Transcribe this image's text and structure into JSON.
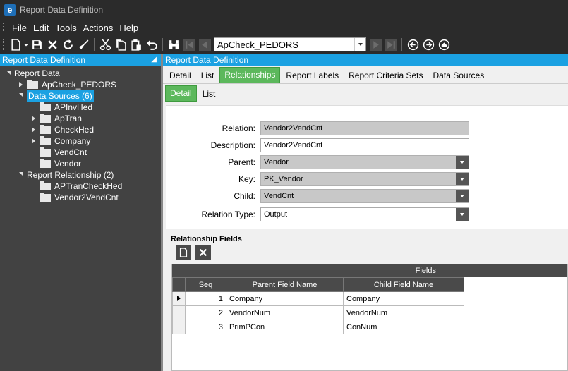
{
  "window": {
    "title": "Report Data Definition",
    "logo_letter": "e"
  },
  "menu": [
    "File",
    "Edit",
    "Tools",
    "Actions",
    "Help"
  ],
  "toolbar": {
    "record_selector": "ApCheck_PEDORS"
  },
  "left_panel": {
    "title": "Report Data Definition",
    "tree": [
      {
        "label": "Report Data",
        "level": 0,
        "state": "expanded",
        "folder": false
      },
      {
        "label": "ApCheck_PEDORS",
        "level": 1,
        "state": "collapsed",
        "folder": true
      },
      {
        "label": "Data Sources (6)",
        "level": 1,
        "state": "expanded",
        "folder": false,
        "selected": true
      },
      {
        "label": "APInvHed",
        "level": 2,
        "state": "none",
        "folder": true
      },
      {
        "label": "ApTran",
        "level": 2,
        "state": "collapsed",
        "folder": true
      },
      {
        "label": "CheckHed",
        "level": 2,
        "state": "collapsed",
        "folder": true
      },
      {
        "label": "Company",
        "level": 2,
        "state": "collapsed",
        "folder": true
      },
      {
        "label": "VendCnt",
        "level": 2,
        "state": "none",
        "folder": true
      },
      {
        "label": "Vendor",
        "level": 2,
        "state": "none",
        "folder": true
      },
      {
        "label": "Report Relationship (2)",
        "level": 1,
        "state": "expanded",
        "folder": false
      },
      {
        "label": "APTranCheckHed",
        "level": 2,
        "state": "none",
        "folder": true
      },
      {
        "label": "Vendor2VendCnt",
        "level": 2,
        "state": "none",
        "folder": true
      }
    ]
  },
  "right_panel": {
    "title": "Report Data Definition",
    "tabs": [
      "Detail",
      "List",
      "Relationships",
      "Report Labels",
      "Report Criteria Sets",
      "Data Sources"
    ],
    "active_tab": "Relationships",
    "subtabs": [
      "Detail",
      "List"
    ],
    "active_subtab": "Detail",
    "form": {
      "relation_label": "Relation:",
      "relation_value": "Vendor2VendCnt",
      "description_label": "Description:",
      "description_value": "Vendor2VendCnt",
      "parent_label": "Parent:",
      "parent_value": "Vendor",
      "key_label": "Key:",
      "key_value": "PK_Vendor",
      "child_label": "Child:",
      "child_value": "VendCnt",
      "relation_type_label": "Relation Type:",
      "relation_type_value": "Output"
    },
    "relationship_fields": {
      "title": "Relationship Fields",
      "band_label": "Fields",
      "columns": [
        "Seq",
        "Parent Field Name",
        "Child Field Name"
      ],
      "rows": [
        {
          "seq": "1",
          "parent": "Company",
          "child": "Company",
          "current": true
        },
        {
          "seq": "2",
          "parent": "VendorNum",
          "child": "VendorNum",
          "current": false
        },
        {
          "seq": "3",
          "parent": "PrimPCon",
          "child": "ConNum",
          "current": false
        }
      ]
    }
  },
  "colors": {
    "accent": "#1ba1e2",
    "active_tab": "#5cb85c",
    "dark_bg": "#2b2b2b",
    "panel_bg": "#424242"
  }
}
